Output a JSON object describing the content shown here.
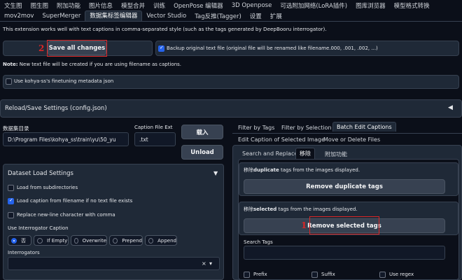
{
  "top_tabs_row1": [
    "文生图",
    "图生图",
    "附加功能",
    "图片信息",
    "模型合并",
    "训练",
    "OpenPose 编辑器",
    "3D Openpose",
    "可选附加网络(LoRA插件)",
    "图库浏览器",
    "模型格式转换"
  ],
  "top_tabs_row2": [
    "mov2mov",
    "SuperMerger",
    "数据集标签编辑器",
    "Vector Studio",
    "Tag反推(Tagger)",
    "设置",
    "扩展"
  ],
  "active_tab": "数据集标签编辑器",
  "intro_text": "This extension works well with text captions in comma-separated style (such as the tags generated by DeepBooru interrogator).",
  "save_button": "Save all changes",
  "backup_label": "Backup original text file (original file will be renamed like filename.000, .001, .002, ...)",
  "backup_checked": true,
  "note_bold": "Note:",
  "note_text": " New text file will be created if you are using filename as captions.",
  "kohya_label": "Use kohya-ss's finetuning metadata json",
  "kohya_checked": false,
  "reload_header": "Reload/Save Settings (config.json)",
  "reload_arrow": "◀",
  "dataset_dir_label": "数据集目录",
  "dataset_dir_value": "D:\\Program Files\\kohya_ss\\train\\yu\\50_yu",
  "caption_ext_label": "Caption File Ext",
  "caption_ext_value": ".txt",
  "load_button": "载入",
  "unload_button": "Unload",
  "dataset_load_header": "Dataset Load Settings",
  "dataset_load_arrow": "▼",
  "load_subdirs_label": "Load from subdirectories",
  "load_subdirs_checked": false,
  "load_caption_label": "Load caption from filename if no text file exists",
  "load_caption_checked": true,
  "replace_newline_label": "Replace new-line character with comma",
  "replace_newline_checked": false,
  "interrogator_caption_label": "Use Interrogator Caption",
  "interrogator_options": [
    "否",
    "If Empty",
    "Overwrite",
    "Prepend",
    "Append"
  ],
  "interrogator_selected": "否",
  "interrogators_label": "Interrogators",
  "interrogators_clear": "×",
  "interrogators_arrow": "▾",
  "right_tabs_row1": [
    "Filter by Tags",
    "Filter by Selection",
    "Batch Edit Captions"
  ],
  "right_tabs_row1_active": "Batch Edit Captions",
  "right_tabs_row2": [
    "Edit Caption of Selected Image",
    "Move or Delete Files"
  ],
  "sub_tabs": [
    "Search and Replace",
    "移除",
    "附加功能"
  ],
  "sub_tabs_active": "移除",
  "remove_dup_prefix": "移除",
  "remove_dup_bold": "duplicate",
  "remove_dup_suffix": " tags from the images displayed.",
  "remove_dup_button": "Remove duplicate tags",
  "remove_sel_prefix": "移除",
  "remove_sel_bold": "selected",
  "remove_sel_suffix": " tags from the images displayed.",
  "remove_sel_button": "Remove selected tags",
  "search_tags_label": "Search Tags",
  "search_tags_value": "",
  "prefix_label": "Prefix",
  "suffix_label": "Suffix",
  "regex_label": "Use regex",
  "annotation_1": "1",
  "annotation_2": "2",
  "annotation_color": "#dc2626",
  "accent_color": "#2563eb"
}
